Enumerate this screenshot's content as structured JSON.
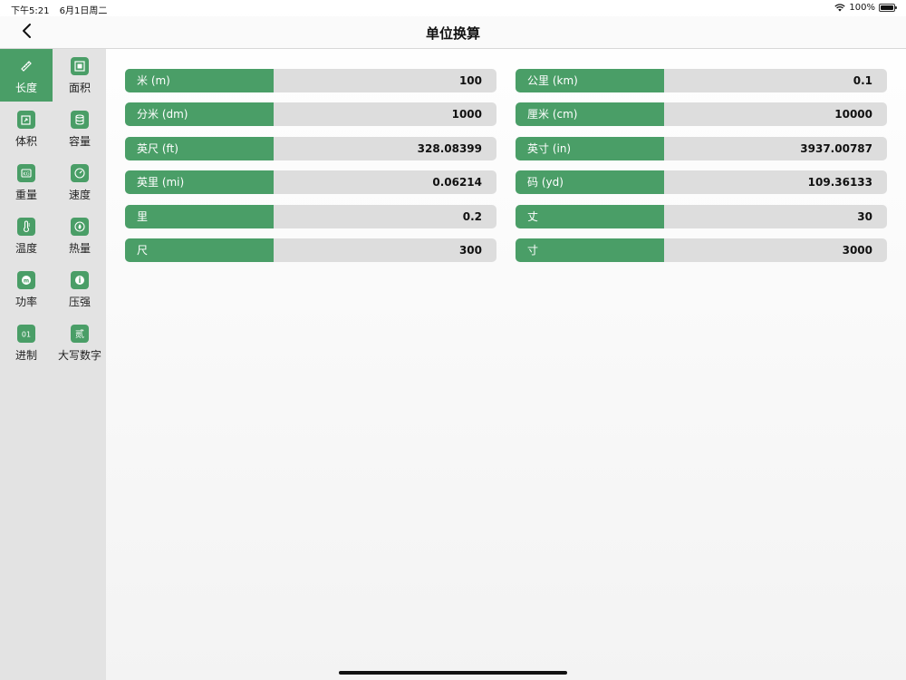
{
  "status": {
    "time": "下午5:21",
    "date": "6月1日周二",
    "battery": "100%"
  },
  "nav": {
    "title": "单位换算"
  },
  "sidebar": {
    "items": [
      {
        "label": "长度",
        "icon": "ruler-icon",
        "active": true
      },
      {
        "label": "面积",
        "icon": "area-icon",
        "active": false
      },
      {
        "label": "体积",
        "icon": "volume-icon",
        "active": false
      },
      {
        "label": "容量",
        "icon": "capacity-icon",
        "active": false
      },
      {
        "label": "重量",
        "icon": "weight-icon",
        "active": false
      },
      {
        "label": "速度",
        "icon": "speedometer-icon",
        "active": false
      },
      {
        "label": "温度",
        "icon": "thermometer-icon",
        "active": false
      },
      {
        "label": "热量",
        "icon": "heat-icon",
        "active": false
      },
      {
        "label": "功率",
        "icon": "power-icon",
        "active": false
      },
      {
        "label": "压强",
        "icon": "pressure-icon",
        "active": false
      },
      {
        "label": "进制",
        "icon": "binary-icon",
        "active": false,
        "glyph": "01"
      },
      {
        "label": "大写数字",
        "icon": "chinese-numeral-icon",
        "active": false,
        "glyph": "贰"
      }
    ]
  },
  "conversions": [
    {
      "unit": "米 (m)",
      "value": "100"
    },
    {
      "unit": "公里 (km)",
      "value": "0.1"
    },
    {
      "unit": "分米 (dm)",
      "value": "1000"
    },
    {
      "unit": "厘米 (cm)",
      "value": "10000"
    },
    {
      "unit": "英尺 (ft)",
      "value": "328.08399"
    },
    {
      "unit": "英寸 (in)",
      "value": "3937.00787"
    },
    {
      "unit": "英里 (mi)",
      "value": "0.06214"
    },
    {
      "unit": "码 (yd)",
      "value": "109.36133"
    },
    {
      "unit": "里",
      "value": "0.2"
    },
    {
      "unit": "丈",
      "value": "30"
    },
    {
      "unit": "尺",
      "value": "300"
    },
    {
      "unit": "寸",
      "value": "3000"
    }
  ],
  "colors": {
    "accent": "#4a9e67",
    "field_bg": "#dddddd",
    "sidebar_bg": "#e3e3e3"
  }
}
